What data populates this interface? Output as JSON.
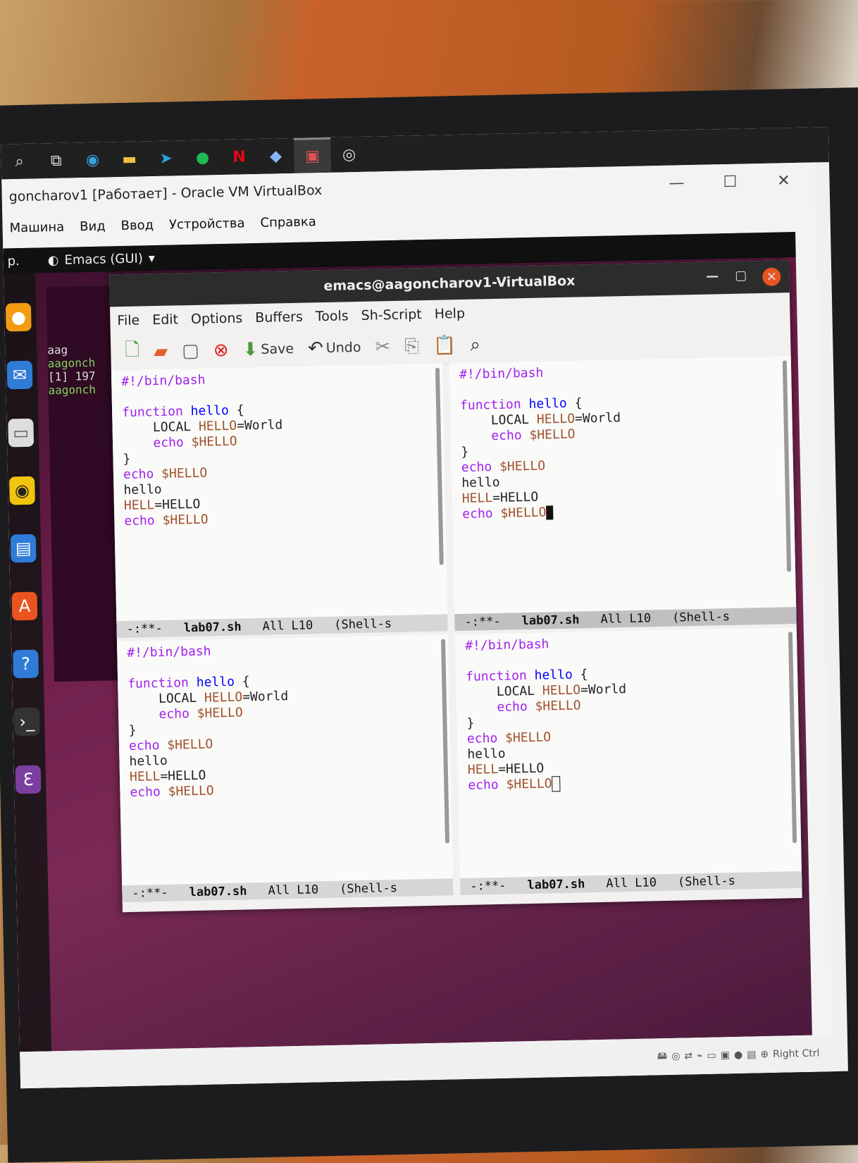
{
  "taskbar": {
    "icons": [
      "search-icon",
      "task-view-icon",
      "edge-icon",
      "explorer-icon",
      "telegram-icon",
      "spotify-icon",
      "netflix-icon",
      "virtualbox-icon",
      "app-icon",
      "obs-icon"
    ]
  },
  "vbox": {
    "title": "goncharov1 [Работает] - Oracle VM VirtualBox",
    "menu": [
      "Машина",
      "Вид",
      "Ввод",
      "Устройства",
      "Справка"
    ],
    "status_hostkey": "Right Ctrl"
  },
  "guest": {
    "activities": "p.",
    "app_name": "Emacs (GUI)",
    "terminal_lines": [
      "aag",
      "aagonch",
      "[1] 197",
      "aagonch"
    ]
  },
  "emacs": {
    "title": "emacs@aagoncharov1-VirtualBox",
    "menu": [
      "File",
      "Edit",
      "Options",
      "Buffers",
      "Tools",
      "Sh-Script",
      "Help"
    ],
    "toolbar": {
      "save_label": "Save",
      "undo_label": "Undo"
    },
    "panes": [
      {
        "buffer": "lab07.sh",
        "modified": "-:**-",
        "position": "All L10",
        "mode": "(Shell-s"
      },
      {
        "buffer": "lab07.sh",
        "modified": "-:**-",
        "position": "All L10",
        "mode": "(Shell-s"
      },
      {
        "buffer": "lab07.sh",
        "modified": "-:**-",
        "position": "All L10",
        "mode": "(Shell-s"
      },
      {
        "buffer": "lab07.sh",
        "modified": "-:**-",
        "position": "All L10",
        "mode": "(Shell-s"
      }
    ],
    "code": {
      "shebang": "#!/bin/bash",
      "kw_function": "function",
      "fn_name": "hello",
      "brace_open": " {",
      "local": "    LOCAL ",
      "hello_var": "HELLO",
      "world": "=World",
      "echo": "echo",
      "dollar_hello": " $HELLO",
      "brace_close": "}",
      "hello_call": "hello",
      "hell_var": "HELL",
      "hell_assign": "=HELLO"
    }
  }
}
